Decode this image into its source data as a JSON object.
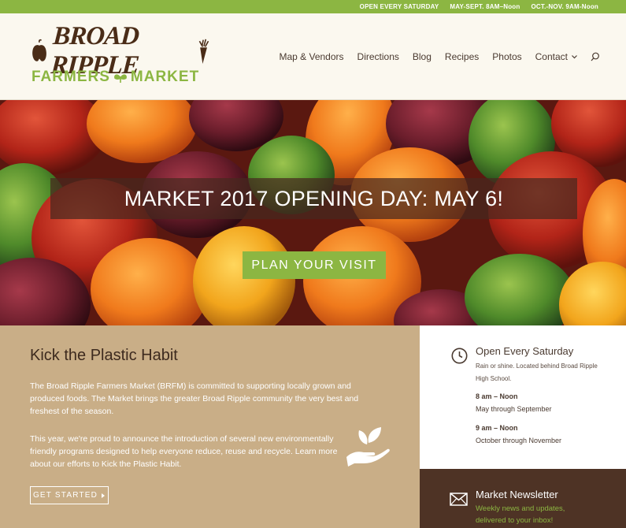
{
  "topbar": {
    "item1": "OPEN EVERY SATURDAY",
    "item2": "MAY-SEPT. 8AM–Noon",
    "item3": "OCT.-NOV. 9AM-Noon"
  },
  "logo": {
    "line1": "BROAD RIPPLE",
    "line2_a": "FARMERS",
    "line2_b": "MARKET"
  },
  "nav": {
    "items": [
      "Map & Vendors",
      "Directions",
      "Blog",
      "Recipes",
      "Photos",
      "Contact"
    ]
  },
  "hero": {
    "title": "MARKET 2017 OPENING DAY: MAY 6!",
    "button": "PLAN YOUR VISIT"
  },
  "kick": {
    "heading": "Kick the Plastic Habit",
    "para1": "The Broad Ripple Farmers Market (BRFM) is committed to supporting locally grown and produced foods. The Market brings the greater Broad Ripple community the very best and freshest of the season.",
    "para2": "This year, we're proud to announce the introduction of several new environmentally friendly programs designed to help everyone reduce, reuse and recycle. Learn more about our efforts to Kick the Plastic Habit.",
    "button": "GET STARTED"
  },
  "hours": {
    "heading": "Open Every Saturday",
    "sub": "Rain or shine. Located behind Broad Ripple High School.",
    "time1": "8 am – Noon",
    "range1": "May through September",
    "time2": "9 am – Noon",
    "range2": "October through November"
  },
  "newsletter": {
    "heading": "Market Newsletter",
    "sub": "Weekly news and updates, delivered to your inbox!"
  },
  "colors": {
    "green": "#8cb642",
    "brown": "#4e3325",
    "tan": "#c9ae87",
    "cream": "#fbf8ef"
  }
}
